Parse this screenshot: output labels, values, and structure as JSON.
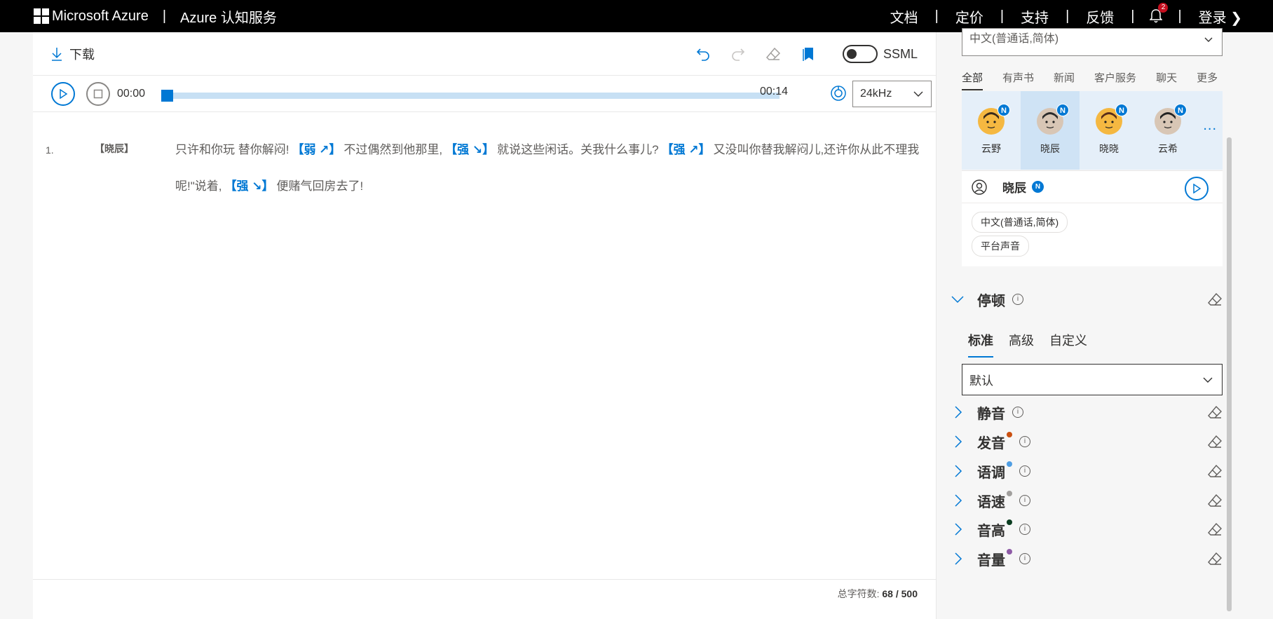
{
  "topnav": {
    "brand": "Microsoft Azure",
    "service": "Azure 认知服务",
    "links": [
      "文档",
      "定价",
      "支持",
      "反馈"
    ],
    "notifications": "2",
    "login": "登录"
  },
  "toolbar": {
    "download_label": "下载",
    "ssml_label": "SSML"
  },
  "player": {
    "current_time": "00:00",
    "end_time": "00:14",
    "progress": 0.0,
    "sample_rate": "24kHz"
  },
  "editor": {
    "line_number": "1.",
    "speaker_tag": "【晓辰】",
    "segments": [
      {
        "type": "text",
        "value": "只许和你玩 替你解闷!"
      },
      {
        "type": "tag",
        "value": "【弱 ↗】"
      },
      {
        "type": "text",
        "value": "不过偶然到他那里,"
      },
      {
        "type": "tag",
        "value": "【强 ↘】"
      },
      {
        "type": "text",
        "value": "就说这些闲话。关我什么事儿?"
      },
      {
        "type": "tag",
        "value": "【强 ↗】"
      },
      {
        "type": "text",
        "value": "又没叫你替我解闷儿,还许你从此不理我呢!\"说着,"
      },
      {
        "type": "tag",
        "value": "【强 ↘】"
      },
      {
        "type": "text",
        "value": "便赌气回房去了!"
      }
    ],
    "char_count_label": "总字符数:",
    "char_count": "68 / 500"
  },
  "rightpanel": {
    "language_select": "中文(普通话,简体)",
    "categories": [
      "全部",
      "有声书",
      "新闻",
      "客户服务",
      "聊天",
      "更多"
    ],
    "voices": [
      {
        "name": "云野",
        "badge": "N",
        "skin": "#f5b841",
        "hair": "#3a2a1a"
      },
      {
        "name": "晓辰",
        "badge": "N",
        "skin": "#d8c6b5",
        "hair": "#2b2b2b"
      },
      {
        "name": "晓晓",
        "badge": "N",
        "skin": "#f5b841",
        "hair": "#5a2d1a"
      },
      {
        "name": "云希",
        "badge": "N",
        "skin": "#d8c6b5",
        "hair": "#222"
      }
    ],
    "more_voices": "...",
    "selected_voice": {
      "name": "晓辰",
      "badge": "N",
      "chips": [
        "中文(普通话,简体)",
        "平台声音"
      ]
    },
    "pause": {
      "title": "停顿",
      "tabs": [
        "标准",
        "高级",
        "自定义"
      ],
      "select_value": "默认"
    },
    "sections": [
      {
        "title": "静音",
        "dot": ""
      },
      {
        "title": "发音",
        "dot": "#ca5010"
      },
      {
        "title": "语调",
        "dot": "#4f9ee3"
      },
      {
        "title": "语速",
        "dot": "#a19f9d"
      },
      {
        "title": "音高",
        "dot": "#0b3d20"
      },
      {
        "title": "音量",
        "dot": "#8e5ba6"
      }
    ],
    "info_icon_text": "i"
  },
  "colors": {
    "accent": "#0078d4",
    "nav_bg": "#000000"
  }
}
